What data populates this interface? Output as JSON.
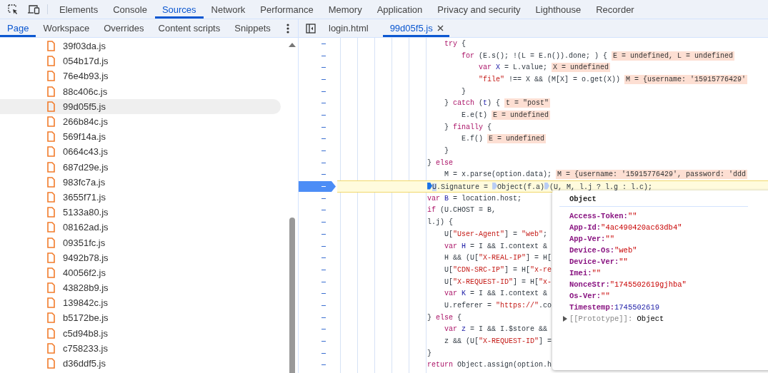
{
  "toolbar": {
    "tabs": [
      {
        "label": "Elements",
        "selected": false
      },
      {
        "label": "Console",
        "selected": false
      },
      {
        "label": "Sources",
        "selected": true
      },
      {
        "label": "Network",
        "selected": false
      },
      {
        "label": "Performance",
        "selected": false
      },
      {
        "label": "Memory",
        "selected": false
      },
      {
        "label": "Application",
        "selected": false
      },
      {
        "label": "Privacy and security",
        "selected": false
      },
      {
        "label": "Lighthouse",
        "selected": false
      },
      {
        "label": "Recorder",
        "selected": false
      }
    ]
  },
  "navigator": {
    "tabs": [
      {
        "label": "Page",
        "selected": true
      },
      {
        "label": "Workspace",
        "selected": false
      },
      {
        "label": "Overrides",
        "selected": false
      },
      {
        "label": "Content scripts",
        "selected": false
      },
      {
        "label": "Snippets",
        "selected": false
      }
    ],
    "files": [
      {
        "name": "39f03da.js",
        "selected": false
      },
      {
        "name": "054b17d.js",
        "selected": false
      },
      {
        "name": "76e4b93.js",
        "selected": false
      },
      {
        "name": "88c406c.js",
        "selected": false
      },
      {
        "name": "99d05f5.js",
        "selected": true
      },
      {
        "name": "266b84c.js",
        "selected": false
      },
      {
        "name": "569f14a.js",
        "selected": false
      },
      {
        "name": "0664c43.js",
        "selected": false
      },
      {
        "name": "687d29e.js",
        "selected": false
      },
      {
        "name": "983fc7a.js",
        "selected": false
      },
      {
        "name": "3655f71.js",
        "selected": false
      },
      {
        "name": "5133a80.js",
        "selected": false
      },
      {
        "name": "08162ad.js",
        "selected": false
      },
      {
        "name": "09351fc.js",
        "selected": false
      },
      {
        "name": "9492b78.js",
        "selected": false
      },
      {
        "name": "40056f2.js",
        "selected": false
      },
      {
        "name": "43828b9.js",
        "selected": false
      },
      {
        "name": "139842c.js",
        "selected": false
      },
      {
        "name": "b5172be.js",
        "selected": false
      },
      {
        "name": "c5d94b8.js",
        "selected": false
      },
      {
        "name": "c758233.js",
        "selected": false
      },
      {
        "name": "d36ddf5.js",
        "selected": false
      }
    ]
  },
  "editor": {
    "tabs": [
      {
        "label": "login.html",
        "selected": false,
        "closable": false
      },
      {
        "label": "99d05f5.js",
        "selected": true,
        "closable": true
      }
    ],
    "lines": [
      {
        "current": false,
        "tokens": [
          {
            "text": "                        try",
            "kind": "keyword"
          },
          {
            "text": " {",
            "kind": "plain"
          }
        ]
      },
      {
        "current": false,
        "tokens": [
          {
            "text": "                            for",
            "kind": "keyword"
          },
          {
            "text": " (E.s(); !(L = E.n()).done; ) {",
            "kind": "plain"
          }
        ],
        "inline_value": "E = undefined, L = undefined"
      },
      {
        "current": false,
        "tokens": [
          {
            "text": "                                var",
            "kind": "keyword"
          },
          {
            "text": " X",
            "kind": "def"
          },
          {
            "text": " = L.value;",
            "kind": "plain"
          }
        ],
        "inline_value": "X = undefined"
      },
      {
        "current": false,
        "tokens": [
          {
            "text": "                                \"file\"",
            "kind": "string"
          },
          {
            "text": " !== X && (M[X] = o.get(X))",
            "kind": "plain"
          }
        ],
        "inline_value": "M = {username: '15915776429'"
      },
      {
        "current": false,
        "tokens": [
          {
            "text": "                            }",
            "kind": "plain"
          }
        ]
      },
      {
        "current": false,
        "tokens": [
          {
            "text": "                        } ",
            "kind": "plain"
          },
          {
            "text": "catch",
            "kind": "keyword"
          },
          {
            "text": " (",
            "kind": "plain"
          },
          {
            "text": "t",
            "kind": "def"
          },
          {
            "text": ") {",
            "kind": "plain"
          }
        ],
        "inline_value": "t = \"post\""
      },
      {
        "current": false,
        "tokens": [
          {
            "text": "                            E.e(t)",
            "kind": "plain"
          }
        ],
        "inline_value": "E = undefined"
      },
      {
        "current": false,
        "tokens": [
          {
            "text": "                        } ",
            "kind": "plain"
          },
          {
            "text": "finally",
            "kind": "keyword"
          },
          {
            "text": " {",
            "kind": "plain"
          }
        ]
      },
      {
        "current": false,
        "tokens": [
          {
            "text": "                            E.f()",
            "kind": "plain"
          }
        ],
        "inline_value": "E = undefined"
      },
      {
        "current": false,
        "tokens": [
          {
            "text": "                        }",
            "kind": "plain"
          }
        ]
      },
      {
        "current": false,
        "tokens": [
          {
            "text": "                    } ",
            "kind": "plain"
          },
          {
            "text": "else",
            "kind": "keyword"
          }
        ]
      },
      {
        "current": false,
        "tokens": [
          {
            "text": "                        M = x.parse(option.data);",
            "kind": "plain"
          }
        ],
        "inline_value": "M = {username: '15915776429', password: 'ddd"
      },
      {
        "current": true,
        "tokens": [
          {
            "text": "                    U",
            "kind": "highlight",
            "step_marker": true,
            "selected": true
          },
          {
            "text": ".Signature = ",
            "kind": "plain"
          },
          {
            "text": "Object(f.a)",
            "kind": "plain",
            "step_marker": true,
            "selected": false
          },
          {
            "text": "(U, M, l.j ? l.g : l.c);",
            "kind": "plain",
            "step_marker": true,
            "selected": false
          }
        ]
      },
      {
        "current": false,
        "tokens": [
          {
            "text": "                    var",
            "kind": "keyword"
          },
          {
            "text": " B",
            "kind": "def"
          },
          {
            "text": " = location.host;",
            "kind": "plain"
          }
        ]
      },
      {
        "current": false,
        "tokens": [
          {
            "text": "                    if",
            "kind": "keyword"
          },
          {
            "text": " (U.CHOST = B,",
            "kind": "plain"
          }
        ]
      },
      {
        "current": false,
        "tokens": [
          {
            "text": "                    l.j) {",
            "kind": "plain"
          }
        ]
      },
      {
        "current": false,
        "tokens": [
          {
            "text": "                        U[",
            "kind": "plain"
          },
          {
            "text": "\"User-Agent\"",
            "kind": "string"
          },
          {
            "text": "] = ",
            "kind": "plain"
          },
          {
            "text": "\"web\"",
            "kind": "string"
          },
          {
            "text": ";",
            "kind": "plain"
          }
        ]
      },
      {
        "current": false,
        "tokens": [
          {
            "text": "                        var",
            "kind": "keyword"
          },
          {
            "text": " H",
            "kind": "def"
          },
          {
            "text": " = I && I.context &",
            "kind": "plain"
          }
        ]
      },
      {
        "current": false,
        "tokens": [
          {
            "text": "                        H && (U[",
            "kind": "plain"
          },
          {
            "text": "\"X-REAL-IP\"",
            "kind": "string"
          },
          {
            "text": "] = H[",
            "kind": "plain"
          }
        ]
      },
      {
        "current": false,
        "tokens": [
          {
            "text": "                        U[",
            "kind": "plain"
          },
          {
            "text": "\"CDN-SRC-IP\"",
            "kind": "string"
          },
          {
            "text": "] = H[",
            "kind": "plain"
          },
          {
            "text": "\"x-re",
            "kind": "string"
          }
        ]
      },
      {
        "current": false,
        "tokens": [
          {
            "text": "                        U[",
            "kind": "plain"
          },
          {
            "text": "\"X-REQUEST-ID\"",
            "kind": "string"
          },
          {
            "text": "] = H[",
            "kind": "plain"
          },
          {
            "text": "\"x-",
            "kind": "string"
          }
        ]
      },
      {
        "current": false,
        "tokens": [
          {
            "text": "                        var",
            "kind": "keyword"
          },
          {
            "text": " K",
            "kind": "def"
          },
          {
            "text": " = I && I.context &",
            "kind": "plain"
          }
        ]
      },
      {
        "current": false,
        "tokens": [
          {
            "text": "                        U.referer = ",
            "kind": "plain"
          },
          {
            "text": "\"https://\"",
            "kind": "string"
          },
          {
            "text": ".co",
            "kind": "plain"
          }
        ]
      },
      {
        "current": false,
        "tokens": [
          {
            "text": "                    } ",
            "kind": "plain"
          },
          {
            "text": "else",
            "kind": "keyword"
          },
          {
            "text": " {",
            "kind": "plain"
          }
        ]
      },
      {
        "current": false,
        "tokens": [
          {
            "text": "                        var",
            "kind": "keyword"
          },
          {
            "text": " z",
            "kind": "def"
          },
          {
            "text": " = I && I.$store &&",
            "kind": "plain"
          }
        ]
      },
      {
        "current": false,
        "tokens": [
          {
            "text": "                        z && (U[",
            "kind": "plain"
          },
          {
            "text": "\"X-REQUEST-ID\"",
            "kind": "string"
          },
          {
            "text": "] =",
            "kind": "plain"
          }
        ]
      },
      {
        "current": false,
        "tokens": [
          {
            "text": "                    }",
            "kind": "plain"
          }
        ]
      },
      {
        "current": false,
        "tokens": [
          {
            "text": "                    return",
            "kind": "keyword"
          },
          {
            "text": " Object.assign(option.h",
            "kind": "plain"
          }
        ]
      }
    ]
  },
  "popover": {
    "title": "Object",
    "properties": [
      {
        "key": "Access-Token:",
        "value": "\"\"",
        "kind": "string"
      },
      {
        "key": "App-Id:",
        "value": "\"4ac490420ac63db4\"",
        "kind": "string"
      },
      {
        "key": "App-Ver:",
        "value": "\"\"",
        "kind": "string"
      },
      {
        "key": "Device-Os:",
        "value": "\"web\"",
        "kind": "string"
      },
      {
        "key": "Device-Ver:",
        "value": "\"\"",
        "kind": "string"
      },
      {
        "key": "Imei:",
        "value": "\"\"",
        "kind": "string"
      },
      {
        "key": "NonceStr:",
        "value": "\"1745502619gjhba\"",
        "kind": "string"
      },
      {
        "key": "Os-Ver:",
        "value": "\"\"",
        "kind": "string"
      },
      {
        "key": "Timestemp:",
        "value": "1745502619",
        "kind": "number"
      }
    ],
    "prototype": {
      "key": "[[Prototype]]:",
      "value": "Object",
      "expanded": false
    }
  }
}
